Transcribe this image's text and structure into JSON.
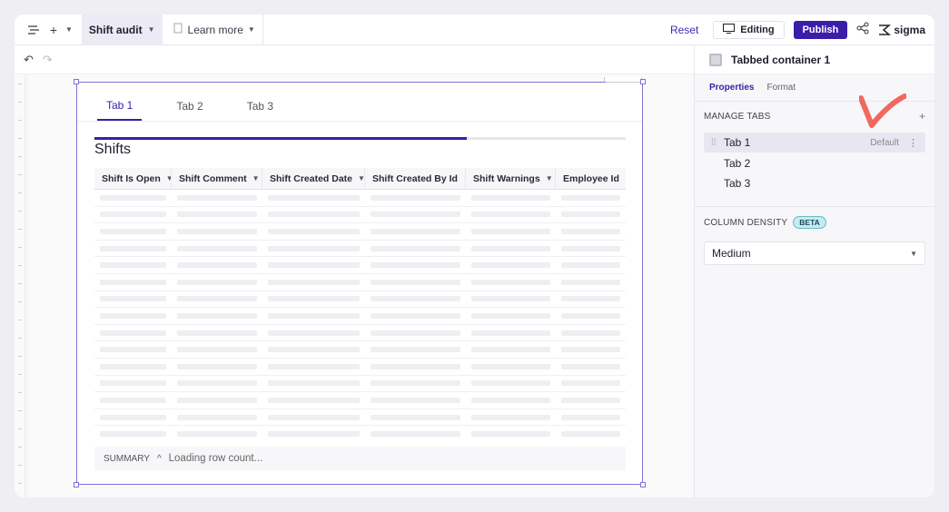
{
  "toolbar": {
    "doc_title": "Shift audit",
    "learn_more": "Learn more",
    "reset": "Reset",
    "editing": "Editing",
    "publish": "Publish",
    "logo": "sigma"
  },
  "container": {
    "tabs": [
      {
        "label": "Tab 1",
        "active": true
      },
      {
        "label": "Tab 2",
        "active": false
      },
      {
        "label": "Tab 3",
        "active": false
      }
    ],
    "table": {
      "title": "Shifts",
      "loading_progress": 0.7,
      "columns": [
        "Shift Is Open",
        "Shift Comment",
        "Shift Created Date",
        "Shift Created By Id",
        "Shift Warnings",
        "Employee Id"
      ]
    },
    "summary": {
      "label": "SUMMARY",
      "status": "Loading row count..."
    }
  },
  "panel": {
    "title": "Tabbed container 1",
    "tabs": [
      "Properties",
      "Format"
    ],
    "manage_tabs": {
      "label": "MANAGE TABS",
      "add": "+",
      "items": [
        {
          "label": "Tab 1",
          "badge": "Default"
        },
        {
          "label": "Tab 2",
          "badge": ""
        },
        {
          "label": "Tab 3",
          "badge": ""
        }
      ]
    },
    "column_density": {
      "label": "COLUMN DENSITY",
      "badge": "BETA",
      "value": "Medium"
    }
  },
  "colors": {
    "accent": "#3b1ea8",
    "annotation": "#f0685f"
  }
}
